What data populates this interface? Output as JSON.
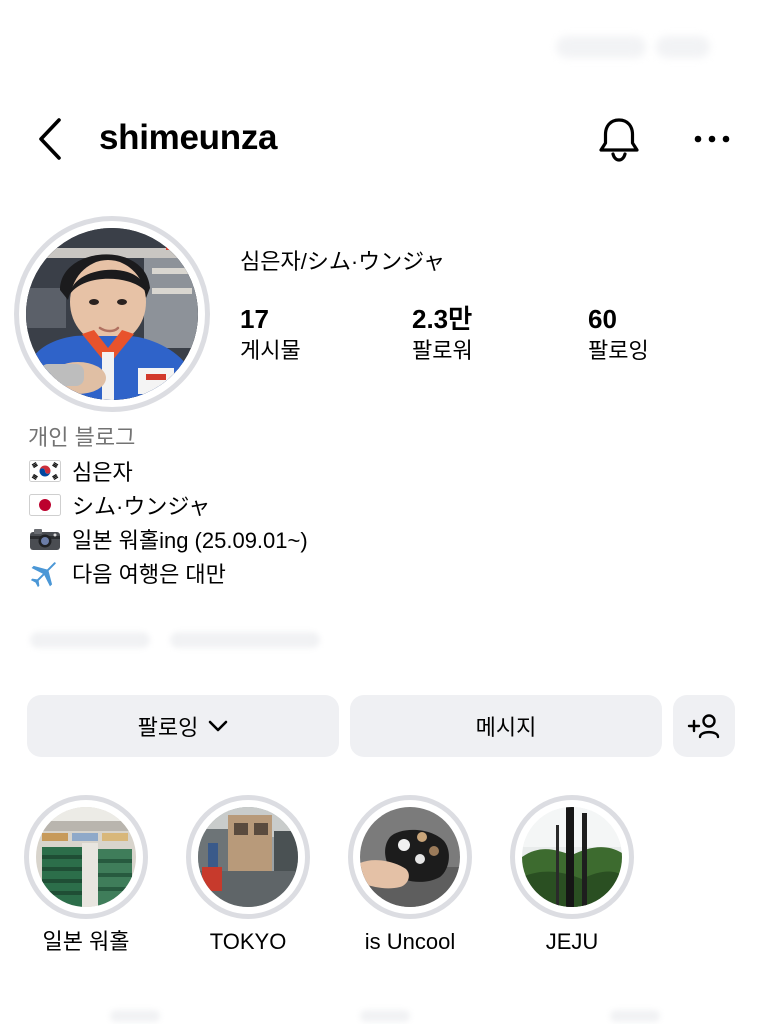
{
  "header": {
    "username": "shimeunza"
  },
  "profile": {
    "display_name": "심은자/シム·ウンジャ",
    "stats": [
      {
        "value": "17",
        "label": "게시물"
      },
      {
        "value": "2.3만",
        "label": "팔로워"
      },
      {
        "value": "60",
        "label": "팔로잉"
      }
    ]
  },
  "bio": {
    "category": "개인 블로그",
    "lines": [
      {
        "icon": "korea-flag-icon",
        "text": "심은자"
      },
      {
        "icon": "japan-flag-icon",
        "text": "シム·ウンジャ"
      },
      {
        "icon": "camera-icon",
        "text": "일본 워홀ing (25.09.01~)"
      },
      {
        "icon": "airplane-icon",
        "text": "다음 여행은 대만"
      }
    ]
  },
  "actions": {
    "following_label": "팔로잉",
    "message_label": "메시지"
  },
  "highlights": [
    {
      "label": "일본 워홀"
    },
    {
      "label": "TOKYO"
    },
    {
      "label": "is Uncool"
    },
    {
      "label": "JEJU"
    }
  ],
  "colors": {
    "button_bg": "#eff0f3",
    "ring": "#dcdde2",
    "muted_text": "#737373"
  }
}
